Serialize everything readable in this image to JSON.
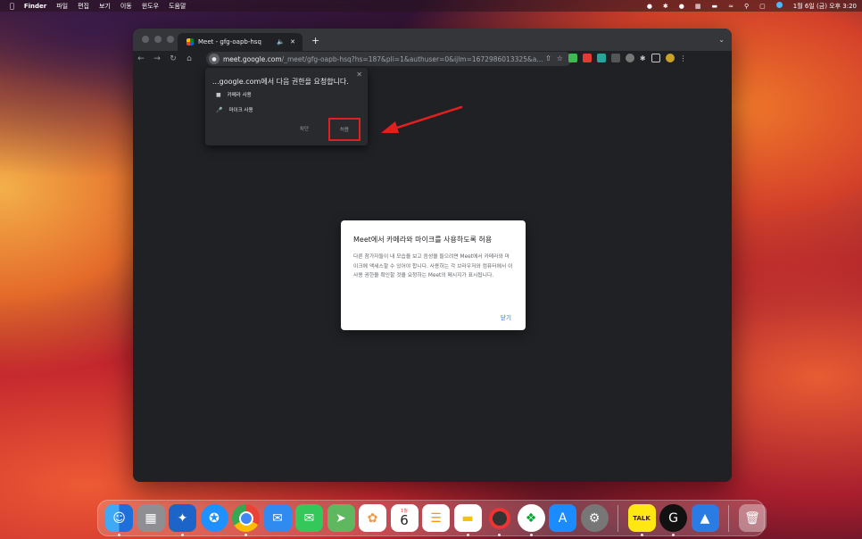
{
  "menubar": {
    "app_name": "Finder",
    "menus": [
      "파일",
      "편집",
      "보기",
      "이동",
      "윈도우",
      "도움말"
    ],
    "clock": "1월 6일 (금) 오후 3:20"
  },
  "browser": {
    "tab_title": "Meet - gfg-oapb-hsq",
    "url_domain": "meet.google.com",
    "url_path": "/_meet/gfg-oapb-hsq?hs=187&pli=1&authuser=0&ijlm=1672986013325&a..."
  },
  "permission_popup": {
    "title": "...google.com에서 다음 권한을 요청합니다.",
    "camera_label": "카메라 사용",
    "mic_label": "마이크 사용",
    "block_label": "차단",
    "allow_label": "허용"
  },
  "meet_dialog": {
    "title": "Meet에서 카메라와 마이크를 사용하도록 허용",
    "body": "다른 참가자들이 내 모습을 보고 음성을 들으려면 Meet에서 카메라와 마이크에 액세스할 수 있어야 합니다. 사용하는 각 브라우저와 컴퓨터에서 이 사용 권한을 확인할 것을 요청하는 Meet의 메시지가 표시됩니다.",
    "close_label": "닫기"
  },
  "dock": {
    "calendar_month": "1월",
    "calendar_day": "6",
    "kakao_label": "TALK"
  },
  "colors": {
    "accent_blue": "#1a73e8",
    "highlight_red": "#e02020"
  }
}
